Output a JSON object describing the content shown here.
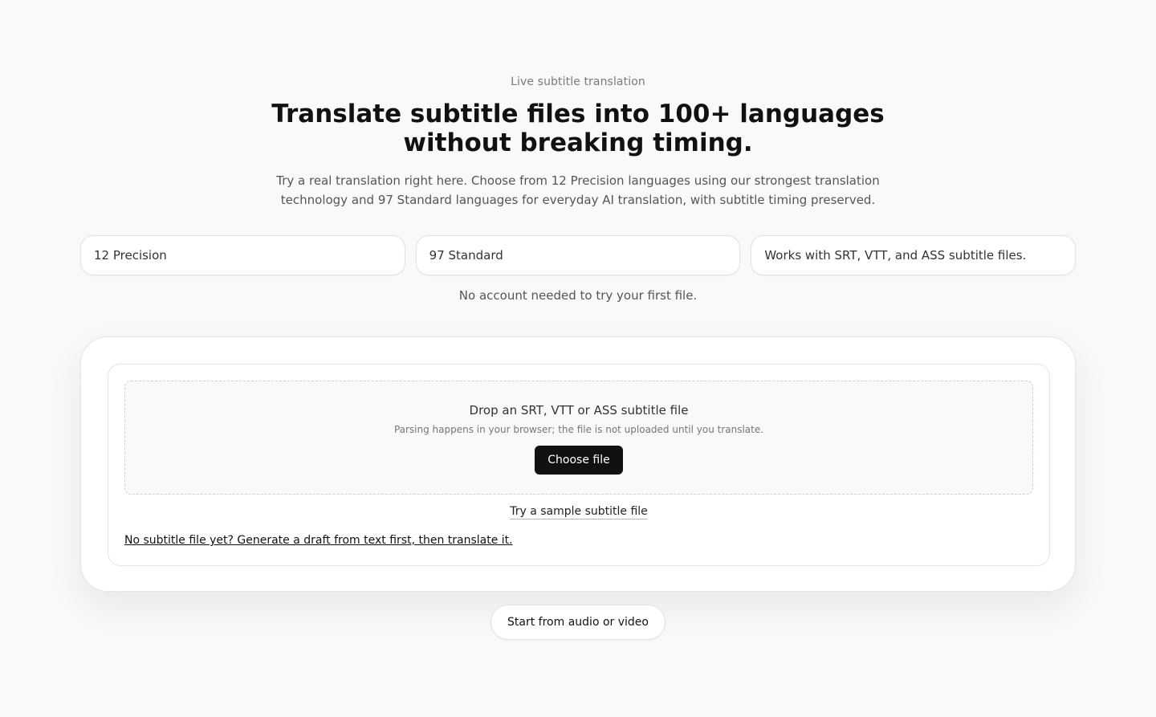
{
  "hero": {
    "eyebrow": "Live subtitle translation",
    "title": "Translate subtitle files into 100+ languages without breaking timing.",
    "description": "Try a real translation right here. Choose from 12 Precision languages using our strongest translation technology and 97 Standard languages for everyday AI translation, with subtitle timing preserved."
  },
  "stats": [
    {
      "label": "12 Precision"
    },
    {
      "label": "97 Standard"
    },
    {
      "label": "Works with SRT, VTT, and ASS subtitle files."
    }
  ],
  "note": "No account needed to try your first file.",
  "upload": {
    "drop_title": "Drop an SRT, VTT or ASS subtitle file",
    "drop_hint": "Parsing happens in your browser; the file is not uploaded until you translate.",
    "choose_label": "Choose file",
    "sample_label": "Try a sample subtitle file",
    "draft_label": "No subtitle file yet? Generate a draft from text first, then translate it."
  },
  "audio_button_label": "Start from audio or video"
}
